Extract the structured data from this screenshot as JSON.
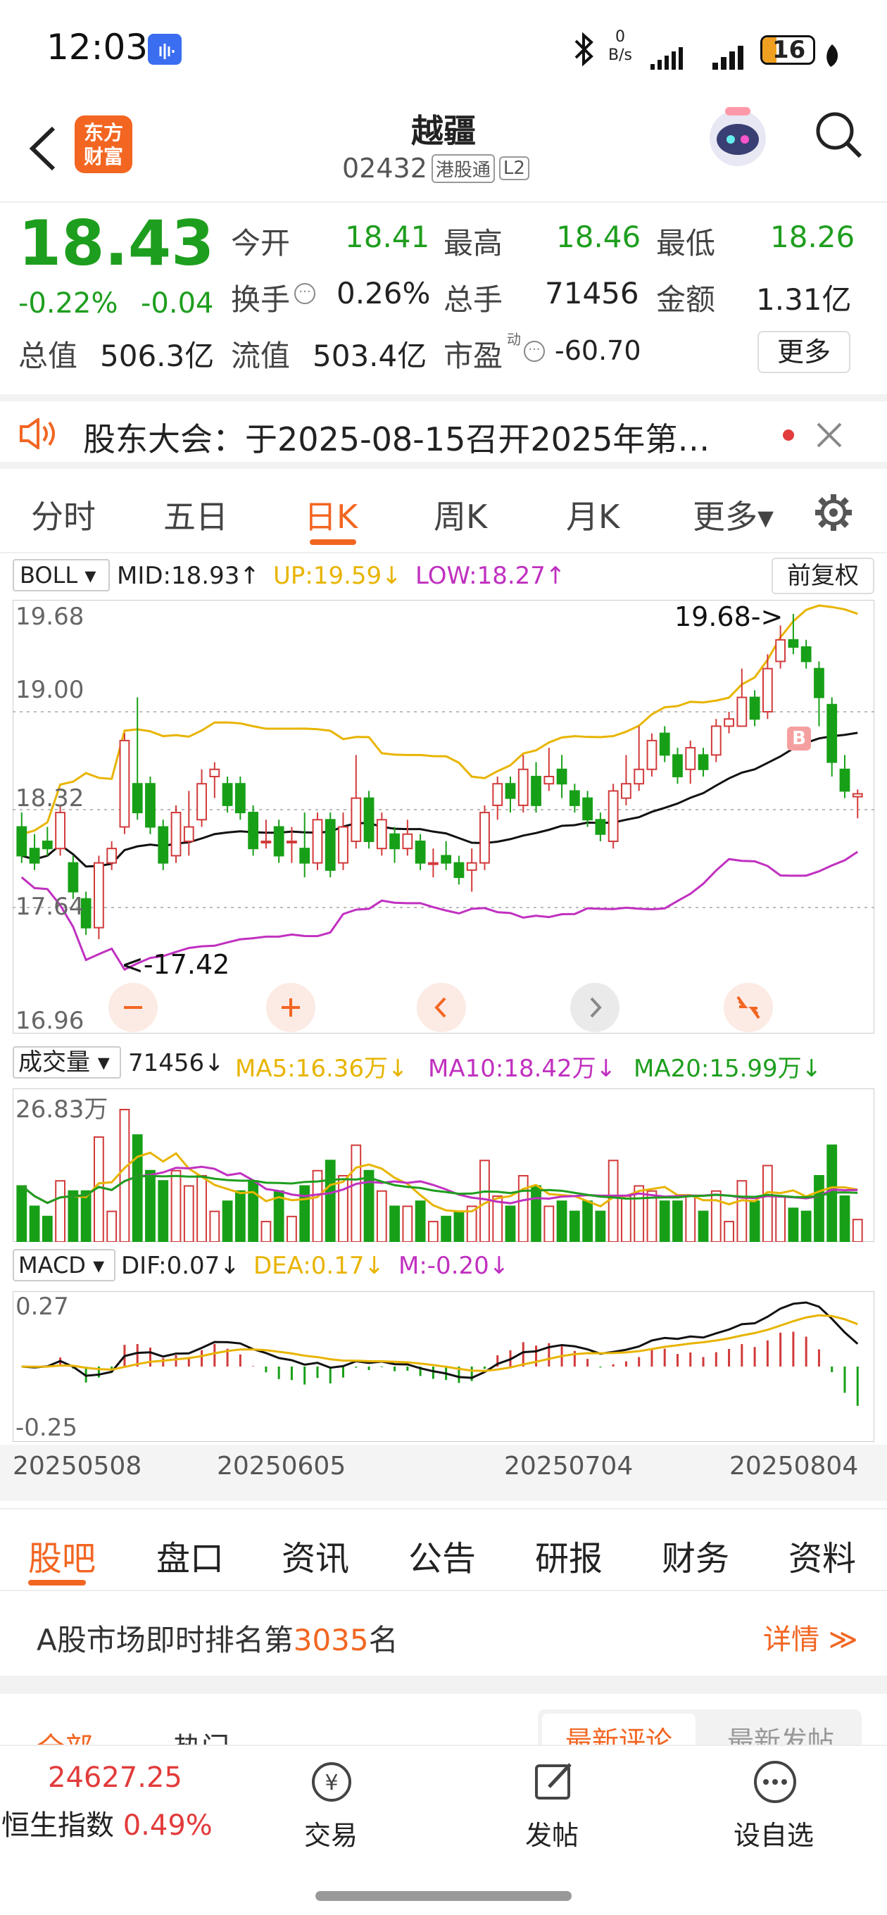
{
  "status_bar": {
    "time": "12:03",
    "net_speed_top": "0",
    "net_speed_unit": "B/s",
    "battery": "16"
  },
  "header": {
    "logo_line1": "东方",
    "logo_line2": "财富",
    "stock_name": "越疆",
    "stock_code": "02432",
    "badge_connect": "港股通",
    "badge_level": "L2"
  },
  "quote": {
    "price": "18.43",
    "change_pct": "-0.22%",
    "change_abs": "-0.04",
    "open_label": "今开",
    "open": "18.41",
    "high_label": "最高",
    "high": "18.46",
    "low_label": "最低",
    "low": "18.26",
    "turnover_label": "换手",
    "turnover": "0.26%",
    "volume_label": "总手",
    "volume": "71456",
    "amount_label": "金额",
    "amount": "1.31亿",
    "mcap_label": "总值",
    "mcap": "506.3亿",
    "float_label": "流值",
    "float_cap": "503.4亿",
    "pe_label": "市盈",
    "pe_sup": "动",
    "pe": "-60.70",
    "more_button": "更多"
  },
  "notice": {
    "text": "股东大会：于2025-08-15召开2025年第…"
  },
  "chart_tabs": [
    "分时",
    "五日",
    "日K",
    "周K",
    "月K",
    "更多▾"
  ],
  "active_tab_index": 2,
  "boll": {
    "indicator": "BOLL",
    "mid": "MID:18.93↑",
    "up": "UP:19.59↓",
    "low": "LOW:18.27↑",
    "adjust_button": "前复权",
    "y_labels": [
      "19.68",
      "19.00",
      "18.32",
      "17.64",
      "16.96"
    ],
    "max_annotation": "19.68->",
    "min_annotation": "<-17.42",
    "b_marker": "B"
  },
  "volume": {
    "indicator": "成交量",
    "value": "71456↓",
    "ma5": "MA5:16.36万↓",
    "ma10": "MA10:18.42万↓",
    "ma20": "MA20:15.99万↓",
    "y_label": "26.83万"
  },
  "macd": {
    "indicator": "MACD",
    "dif": "DIF:0.07↓",
    "dea": "DEA:0.17↓",
    "m": "M:-0.20↓",
    "y_top": "0.27",
    "y_bottom": "-0.25"
  },
  "x_dates": [
    "20250508",
    "20250605",
    "20250704",
    "20250804"
  ],
  "bottom_tabs": [
    "股吧",
    "盘口",
    "资讯",
    "公告",
    "研报",
    "财务",
    "资料"
  ],
  "active_bottom_tab": 0,
  "rank": {
    "prefix": "A股市场即时排名第",
    "rank": "3035",
    "suffix": "名",
    "detail": "详情"
  },
  "sub_tabs": {
    "all": "全部",
    "hot": "热门",
    "latest_comment": "最新评论",
    "latest_post": "最新发帖"
  },
  "bottom_bar": {
    "index_value": "24627.25",
    "index_name": "恒生指数",
    "index_change": "0.49%",
    "trade": "交易",
    "post": "发帖",
    "watchlist": "设自选"
  },
  "chart_data": {
    "type": "candlestick",
    "ylim": [
      16.96,
      19.68
    ],
    "candles": [
      [
        18.2,
        18.0,
        18.3,
        17.95
      ],
      [
        18.05,
        17.95,
        18.15,
        17.9
      ],
      [
        18.1,
        18.05,
        18.2,
        18.0
      ],
      [
        18.05,
        18.3,
        18.35,
        18.0
      ],
      [
        17.95,
        17.75,
        18.0,
        17.7
      ],
      [
        17.7,
        17.5,
        17.75,
        17.45
      ],
      [
        17.5,
        17.95,
        18.0,
        17.42
      ],
      [
        17.95,
        18.05,
        18.1,
        17.9
      ],
      [
        18.2,
        18.8,
        18.85,
        18.15
      ],
      [
        18.5,
        18.3,
        19.1,
        18.25
      ],
      [
        18.5,
        18.2,
        18.55,
        18.15
      ],
      [
        18.2,
        17.95,
        18.25,
        17.9
      ],
      [
        18.0,
        18.3,
        18.35,
        17.95
      ],
      [
        18.1,
        18.2,
        18.45,
        18.0
      ],
      [
        18.25,
        18.5,
        18.6,
        18.2
      ],
      [
        18.55,
        18.6,
        18.65,
        18.4
      ],
      [
        18.5,
        18.35,
        18.55,
        18.3
      ],
      [
        18.5,
        18.3,
        18.55,
        18.25
      ],
      [
        18.3,
        18.05,
        18.35,
        18.0
      ],
      [
        18.1,
        18.1,
        18.25,
        18.05
      ],
      [
        18.2,
        18.0,
        18.25,
        17.95
      ],
      [
        18.1,
        18.1,
        18.2,
        17.95
      ],
      [
        18.05,
        17.95,
        18.3,
        17.85
      ],
      [
        17.95,
        18.25,
        18.3,
        17.9
      ],
      [
        18.25,
        17.9,
        18.3,
        17.85
      ],
      [
        17.95,
        18.2,
        18.3,
        17.9
      ],
      [
        18.1,
        18.4,
        18.7,
        18.05
      ],
      [
        18.4,
        18.1,
        18.45,
        18.05
      ],
      [
        18.05,
        18.25,
        18.3,
        18.0
      ],
      [
        18.15,
        18.05,
        18.2,
        17.95
      ],
      [
        18.05,
        18.15,
        18.25,
        18.0
      ],
      [
        18.1,
        17.95,
        18.15,
        17.9
      ],
      [
        17.95,
        17.95,
        18.05,
        17.85
      ],
      [
        18.0,
        17.95,
        18.1,
        17.9
      ],
      [
        17.95,
        17.85,
        18.0,
        17.8
      ],
      [
        17.9,
        17.95,
        18.05,
        17.75
      ],
      [
        17.95,
        18.3,
        18.35,
        17.9
      ],
      [
        18.35,
        18.5,
        18.55,
        18.25
      ],
      [
        18.5,
        18.4,
        18.55,
        18.3
      ],
      [
        18.35,
        18.6,
        18.7,
        18.3
      ],
      [
        18.55,
        18.35,
        18.65,
        18.3
      ],
      [
        18.5,
        18.55,
        18.75,
        18.45
      ],
      [
        18.6,
        18.5,
        18.7,
        18.4
      ],
      [
        18.45,
        18.35,
        18.5,
        18.3
      ],
      [
        18.4,
        18.25,
        18.45,
        18.2
      ],
      [
        18.25,
        18.15,
        18.3,
        18.1
      ],
      [
        18.1,
        18.45,
        18.5,
        18.05
      ],
      [
        18.4,
        18.5,
        18.7,
        18.35
      ],
      [
        18.5,
        18.6,
        18.9,
        18.45
      ],
      [
        18.6,
        18.8,
        18.85,
        18.55
      ],
      [
        18.85,
        18.7,
        18.9,
        18.65
      ],
      [
        18.7,
        18.55,
        18.75,
        18.5
      ],
      [
        18.6,
        18.75,
        18.8,
        18.5
      ],
      [
        18.7,
        18.6,
        18.75,
        18.55
      ],
      [
        18.7,
        18.9,
        18.95,
        18.65
      ],
      [
        18.9,
        18.95,
        19.0,
        18.85
      ],
      [
        18.9,
        19.1,
        19.3,
        18.9
      ],
      [
        19.1,
        18.95,
        19.15,
        18.9
      ],
      [
        19.0,
        19.3,
        19.4,
        18.95
      ],
      [
        19.35,
        19.5,
        19.6,
        19.3
      ],
      [
        19.5,
        19.45,
        19.68,
        19.4
      ],
      [
        19.45,
        19.35,
        19.5,
        19.3
      ],
      [
        19.3,
        19.1,
        19.35,
        18.9
      ],
      [
        19.05,
        18.65,
        19.1,
        18.55
      ],
      [
        18.6,
        18.45,
        18.7,
        18.4
      ],
      [
        18.41,
        18.43,
        18.46,
        18.26
      ]
    ]
  }
}
